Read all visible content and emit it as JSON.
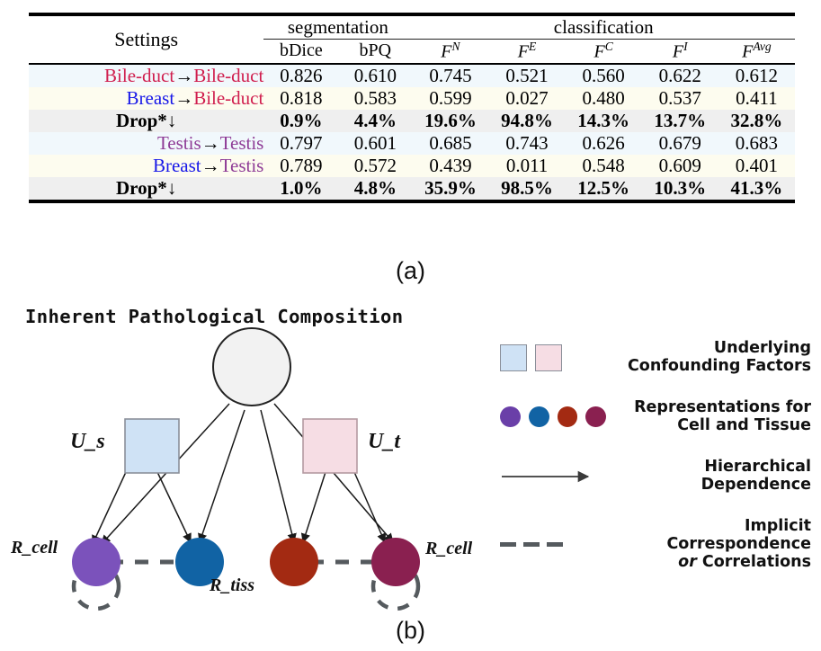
{
  "panel_a": {
    "label": "(a)",
    "header": {
      "settings": "Settings",
      "group_segmentation": "segmentation",
      "group_classification": "classification",
      "cols": [
        {
          "base": "bDice",
          "sup": ""
        },
        {
          "base": "bPQ",
          "sup": ""
        },
        {
          "base": "F",
          "sup": "N"
        },
        {
          "base": "F",
          "sup": "E"
        },
        {
          "base": "F",
          "sup": "C"
        },
        {
          "base": "F",
          "sup": "I"
        },
        {
          "base": "F",
          "sup": "Avg"
        }
      ]
    },
    "rows": [
      {
        "kind": "setting",
        "style": "row-a",
        "source": "Bile-duct",
        "source_color": "bile",
        "arrow": "→",
        "target": "Bile-duct",
        "target_color": "bile",
        "values": [
          "0.826",
          "0.610",
          "0.745",
          "0.521",
          "0.560",
          "0.622",
          "0.612"
        ]
      },
      {
        "kind": "setting",
        "style": "row-b",
        "source": "Breast",
        "source_color": "breast",
        "arrow": "→",
        "target": "Bile-duct",
        "target_color": "bile",
        "values": [
          "0.818",
          "0.583",
          "0.599",
          "0.027",
          "0.480",
          "0.537",
          "0.411"
        ]
      },
      {
        "kind": "drop",
        "style": "row-drop",
        "label": "Drop*↓",
        "values": [
          "0.9%",
          "4.4%",
          "19.6%",
          "94.8%",
          "14.3%",
          "13.7%",
          "32.8%"
        ]
      },
      {
        "kind": "setting",
        "style": "row-a",
        "source": "Testis",
        "source_color": "testis",
        "arrow": "→",
        "target": "Testis",
        "target_color": "testis",
        "values": [
          "0.797",
          "0.601",
          "0.685",
          "0.743",
          "0.626",
          "0.679",
          "0.683"
        ]
      },
      {
        "kind": "setting",
        "style": "row-b",
        "source": "Breast",
        "source_color": "breast",
        "arrow": "→",
        "target": "Testis",
        "target_color": "testis",
        "values": [
          "0.789",
          "0.572",
          "0.439",
          "0.011",
          "0.548",
          "0.609",
          "0.401"
        ]
      },
      {
        "kind": "drop",
        "style": "row-drop",
        "label": "Drop*↓",
        "values": [
          "1.0%",
          "4.8%",
          "35.9%",
          "98.5%",
          "12.5%",
          "10.3%",
          "41.3%"
        ]
      }
    ],
    "text_colors": {
      "bile": "#d01e4e",
      "breast": "#1717e8",
      "testis": "#8e3b96"
    }
  },
  "panel_b": {
    "label": "(b)",
    "title": "Inherent Pathological Composition",
    "nodes": {
      "root": {
        "name": "root-circle",
        "fill": "#f2f2f2",
        "stroke": "#222"
      },
      "u_s": {
        "label": "U_s",
        "fill": "#cfe2f5",
        "stroke": "#8a8f99"
      },
      "u_t": {
        "label": "U_t",
        "fill": "#f6dde4",
        "stroke": "#b49aa1"
      },
      "r_cell_left": {
        "label": "R_cell",
        "fill": "#7b52bb"
      },
      "r_tiss_left": {
        "label": "R_tiss",
        "fill": "#1163a4"
      },
      "r_tiss_right": {
        "label": "",
        "fill": "#a32a12"
      },
      "r_cell_right": {
        "label": "R_cell",
        "fill": "#8a2050"
      }
    },
    "legend": [
      {
        "id": "confounding-factors",
        "glyph": "two-squares",
        "line1": "Underlying",
        "line2": "Confounding Factors",
        "colors": [
          "#cfe2f5",
          "#f6dde4"
        ]
      },
      {
        "id": "representations",
        "glyph": "four-dots",
        "line1": "Representations for",
        "line2": "Cell and Tissue",
        "colors": [
          "#6a3fa8",
          "#1163a4",
          "#a32a12",
          "#8a2050"
        ]
      },
      {
        "id": "hierarchical-dependence",
        "glyph": "solid-arrow",
        "line1": "Hierarchical",
        "line2": "Dependence",
        "colors": [
          "#3a3a3a"
        ]
      },
      {
        "id": "implicit-correspondence",
        "glyph": "dashed-line",
        "line1": "Implicit Correspondence",
        "line2_pre": "or",
        "line2": "Correlations",
        "colors": [
          "#555a5e"
        ]
      }
    ]
  }
}
